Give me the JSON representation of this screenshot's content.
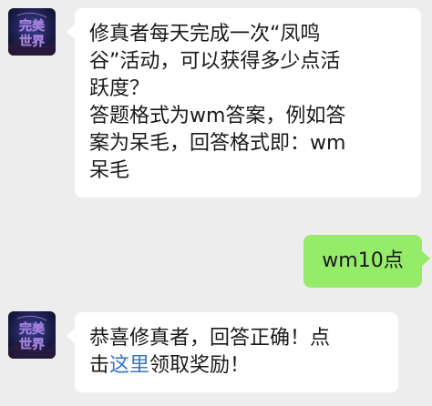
{
  "messages": [
    {
      "sender": "game-account",
      "lines": [
        "修真者每天完成一次“凤鸣",
        "谷”活动，可以获得多少点活",
        "跃度？",
        "答题格式为wm答案，例如答",
        "案为呆毛，回答格式即：wm",
        "呆毛"
      ]
    },
    {
      "sender": "user",
      "text": "wm10点"
    },
    {
      "sender": "game-account",
      "line1": "恭喜修真者，回答正确！点",
      "line2_prefix": "击",
      "link_text": "这里",
      "line2_suffix": "领取奖励！"
    }
  ],
  "avatar": {
    "logo_text_top": "完美",
    "logo_text_bottom": "世界"
  },
  "colors": {
    "background": "#ededed",
    "incoming_bubble": "#ffffff",
    "outgoing_bubble": "#95ec69",
    "link": "#3777c4"
  }
}
